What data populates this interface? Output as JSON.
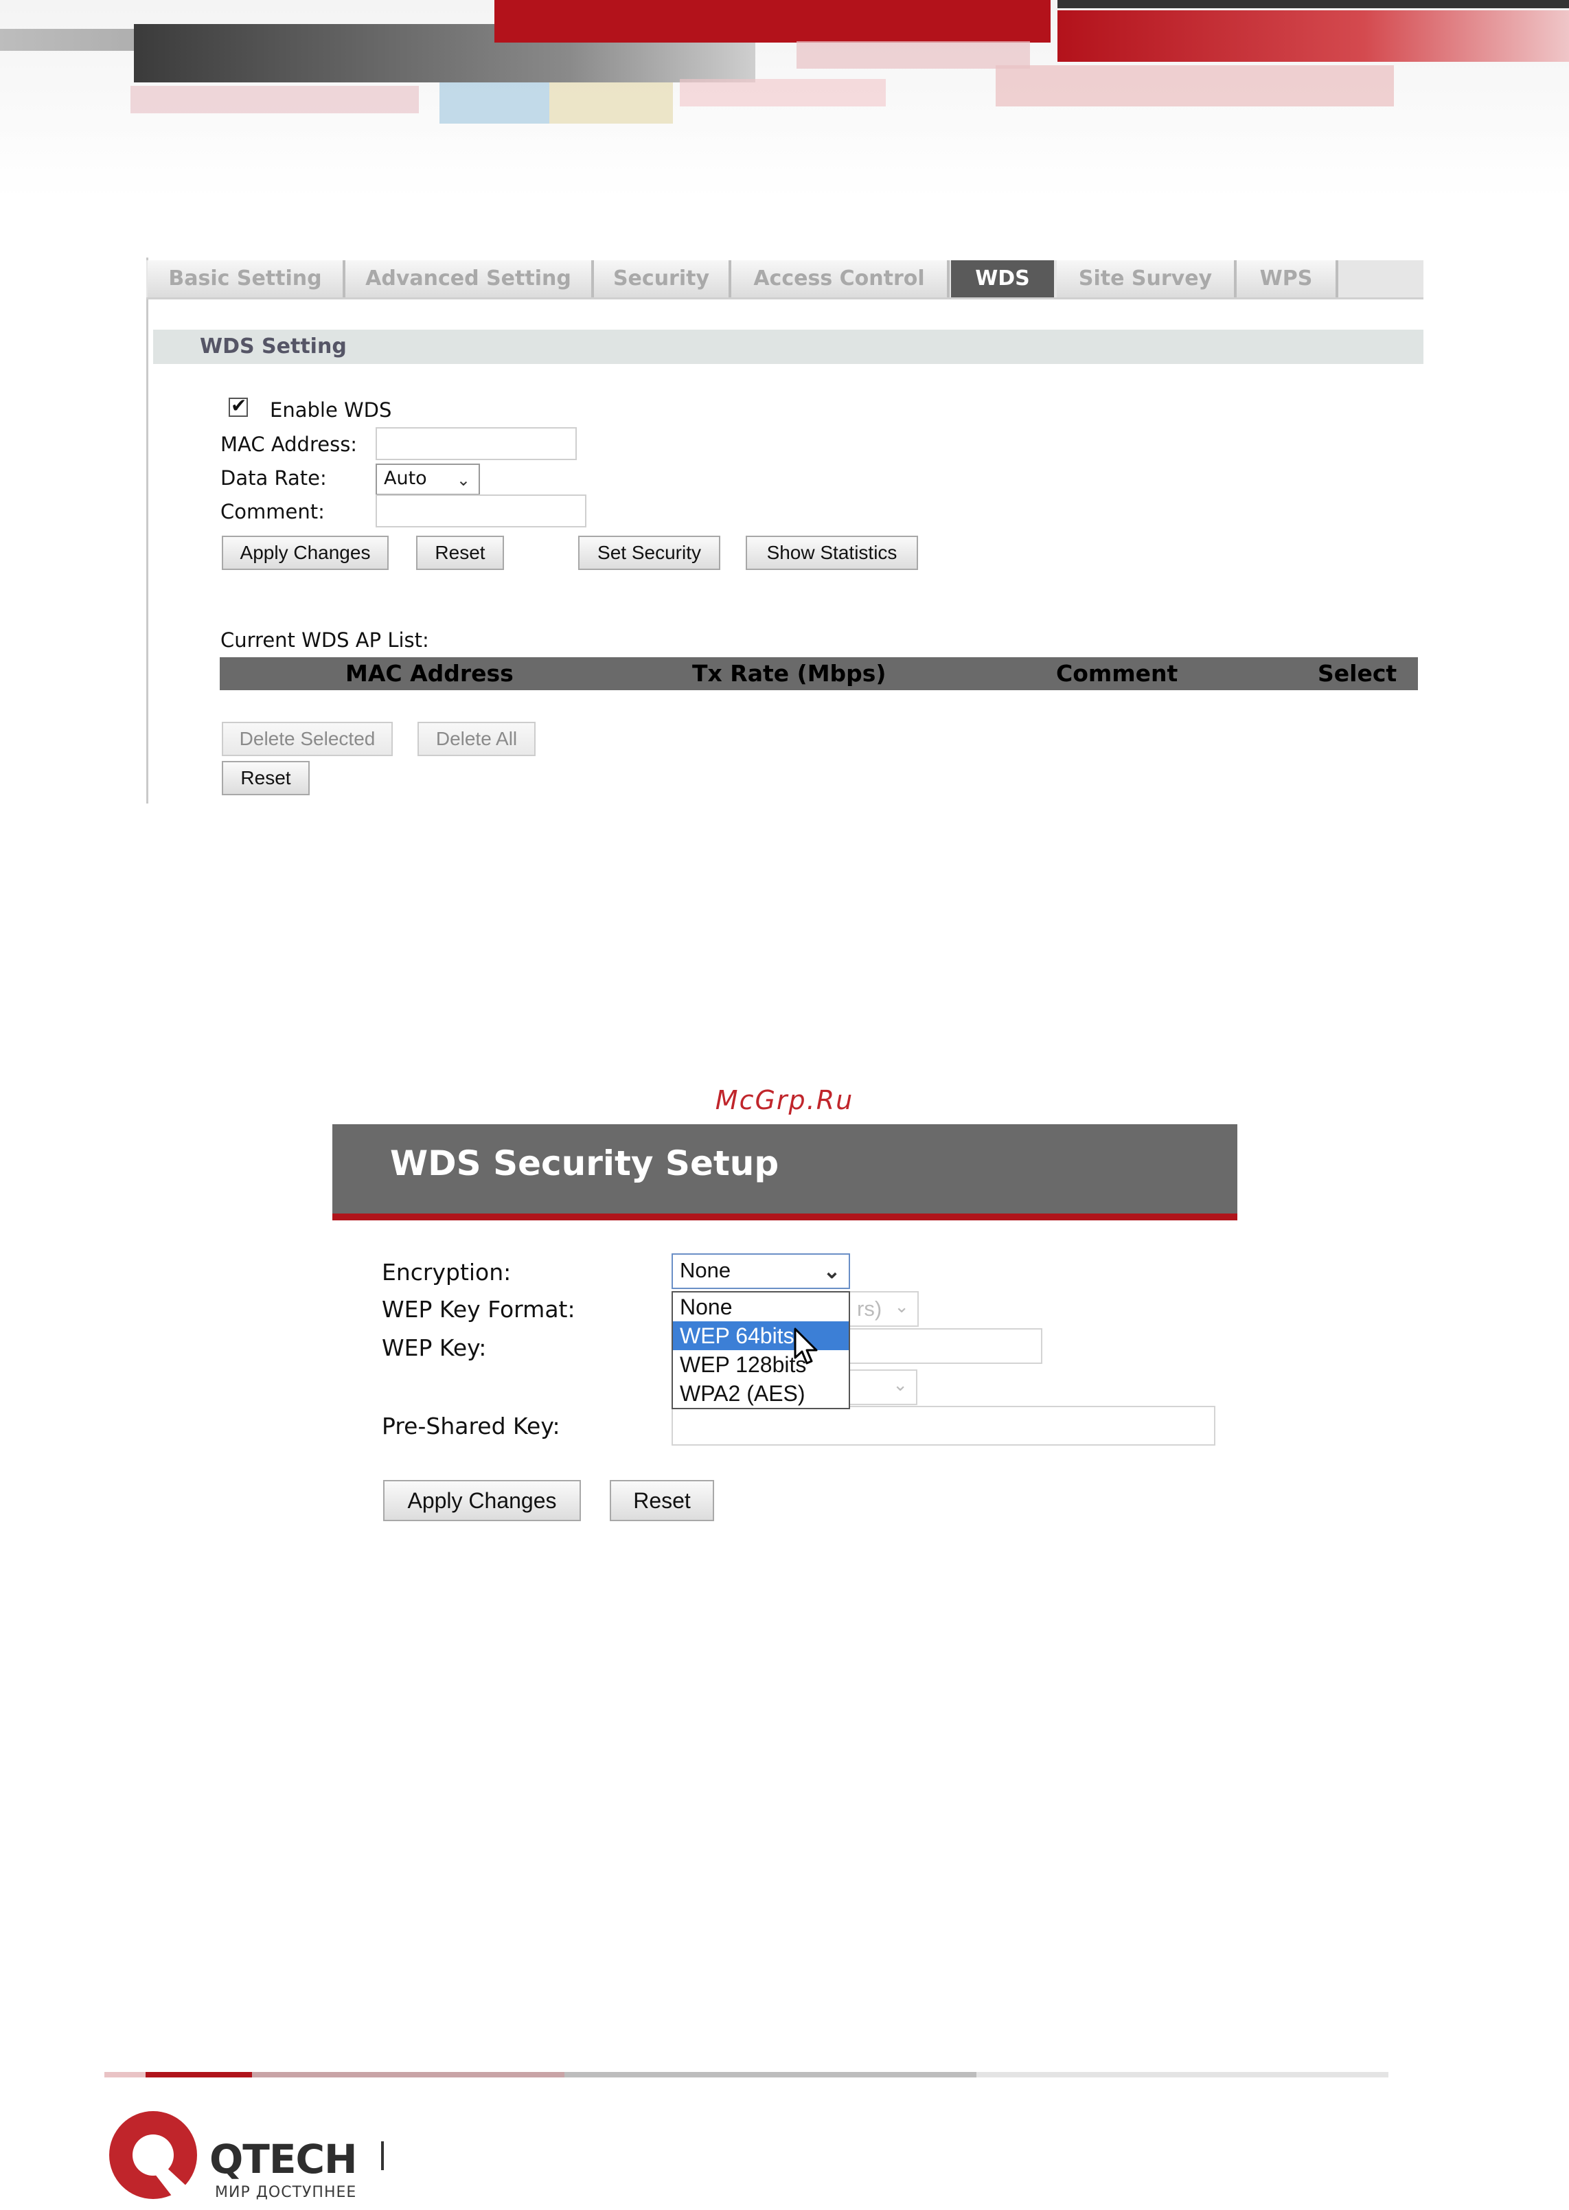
{
  "tabs": [
    "Basic Setting",
    "Advanced Setting",
    "Security",
    "Access Control",
    "WDS",
    "Site Survey",
    "WPS"
  ],
  "wds": {
    "section_title": "WDS Setting",
    "enable_label": "Enable WDS",
    "enable_checked": true,
    "mac_label": "MAC Address:",
    "mac_value": "",
    "rate_label": "Data Rate:",
    "rate_value": "Auto",
    "comment_label": "Comment:",
    "comment_value": "",
    "buttons": {
      "apply": "Apply Changes",
      "reset": "Reset",
      "set_security": "Set Security",
      "show_stats": "Show Statistics"
    },
    "list_label": "Current WDS AP List:",
    "columns": [
      "MAC Address",
      "Tx Rate (Mbps)",
      "Comment",
      "Select"
    ],
    "list_buttons": {
      "delete_selected": "Delete Selected",
      "delete_all": "Delete All",
      "reset": "Reset"
    }
  },
  "watermark": "McGrp.Ru",
  "security": {
    "title": "WDS Security Setup",
    "encryption_label": "Encryption:",
    "encryption_value": "None",
    "encryption_options": [
      "None",
      "WEP 64bits",
      "WEP 128bits",
      "WPA2 (AES)"
    ],
    "highlighted_option": "WEP 64bits",
    "wep_format_label": "WEP Key Format:",
    "wep_format_partial": "rs)",
    "wep_key_label": "WEP Key:",
    "psk_label": "Pre-Shared Key:",
    "buttons": {
      "apply": "Apply Changes",
      "reset": "Reset"
    }
  },
  "footer": {
    "brand": "QTECH",
    "tagline": "МИР ДОСТУПНЕЕ"
  },
  "colors": {
    "brand_red": "#c0252b",
    "header_gray": "#6a6a6a",
    "highlight_blue": "#3c7fd6"
  }
}
